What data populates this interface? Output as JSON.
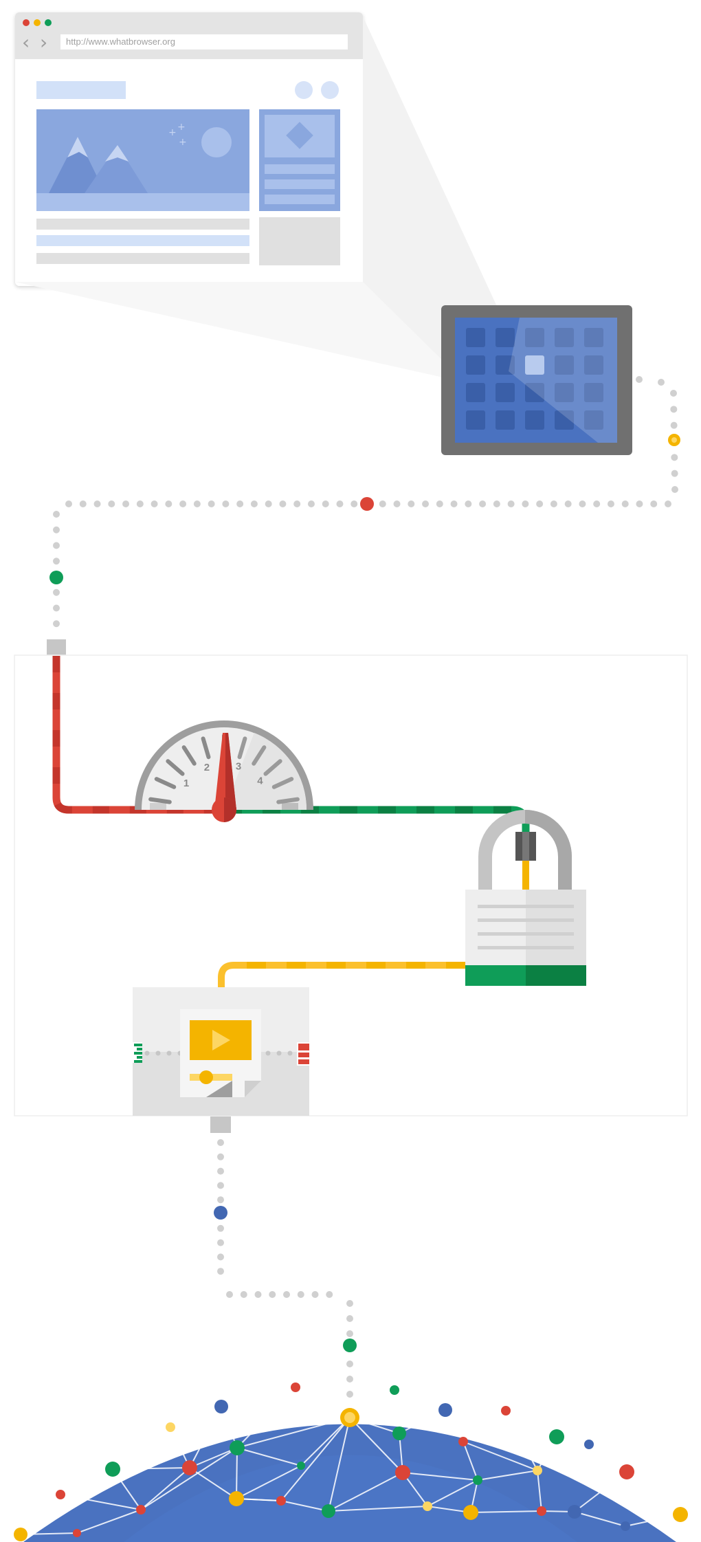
{
  "browser": {
    "url": "http://www.whatbrowser.org",
    "back_glyph": "‹",
    "forward_glyph": "›",
    "window_controls": [
      "close",
      "minimize",
      "maximize"
    ]
  },
  "colors": {
    "red": "#db4437",
    "yellow": "#f4b400",
    "green": "#0f9d58",
    "blue": "#4267b2",
    "tablet_frame": "#707070",
    "tablet_screen": "#4a72c0",
    "globe": "#4a72c0",
    "connector_dots": "#d0d0d0"
  },
  "gauge": {
    "tick_labels": [
      "1",
      "2",
      "3",
      "4"
    ]
  },
  "icons": {
    "tablet": "tablet-icon",
    "speedometer": "speedometer-icon",
    "lock": "padlock-icon",
    "media": "video-player-icon",
    "globe": "network-globe-icon"
  }
}
